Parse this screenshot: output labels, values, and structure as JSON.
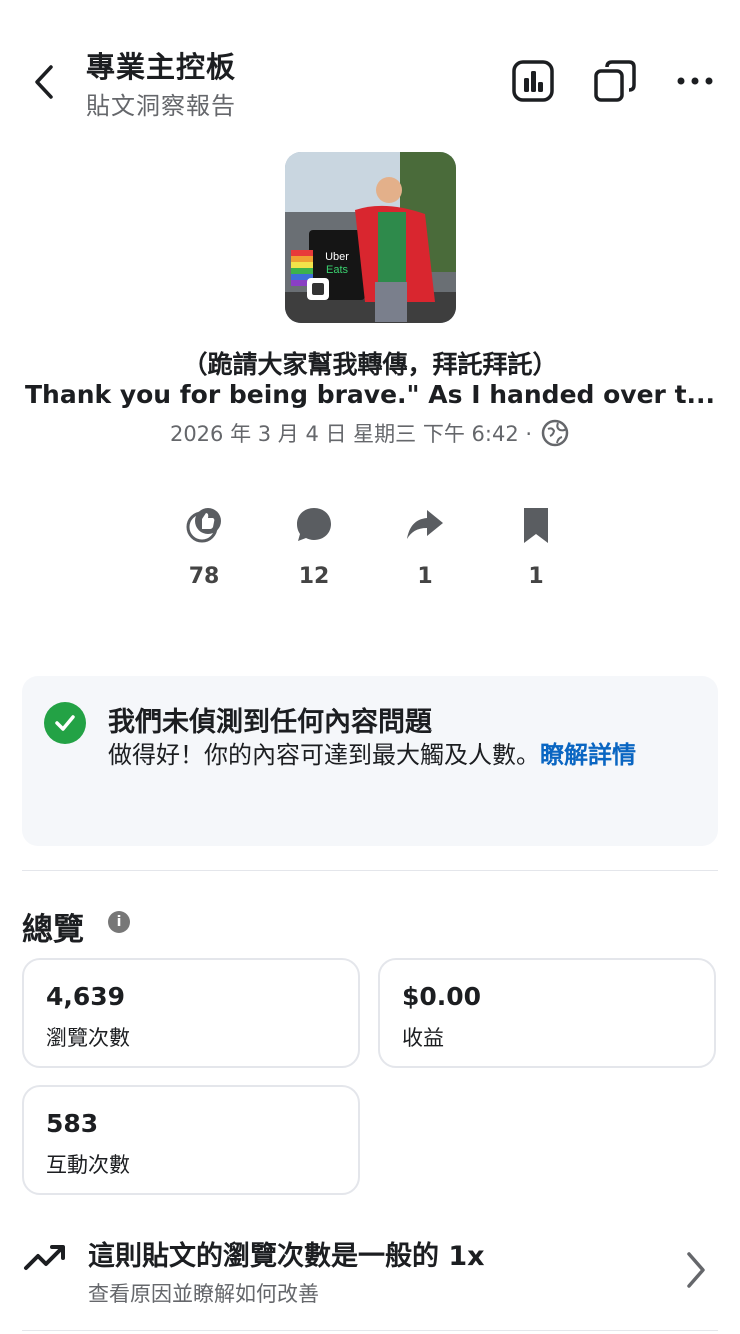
{
  "header": {
    "title": "專業主控板",
    "subtitle": "貼文洞察報告"
  },
  "post": {
    "thumbnail_text": "Uber Eats",
    "line1": "（跪請大家幫我轉傳，拜託拜託）",
    "line2": "Thank you for being brave.\" As I handed over t...",
    "date": "2026 年 3 月 4 日 星期三 下午 6:42 ·"
  },
  "engagement": {
    "reactions": "78",
    "comments": "12",
    "shares": "1",
    "saves": "1"
  },
  "notice": {
    "title": "我們未偵測到任何內容問題",
    "body": "做得好！你的內容可達到最大觸及人數。",
    "link": "瞭解詳情"
  },
  "overview": {
    "title": "總覽",
    "cards": [
      {
        "value": "4,639",
        "label": "瀏覽次數"
      },
      {
        "value": "$0.00",
        "label": "收益"
      },
      {
        "value": "583",
        "label": "互動次數"
      }
    ]
  },
  "trend": {
    "title": "這則貼文的瀏覽次數是一般的 1x",
    "subtitle": "查看原因並瞭解如何改善"
  },
  "colors": {
    "accent_link": "#0a66c2",
    "check_green": "#23a245",
    "muted_text": "#65676b"
  },
  "icons": [
    "back-arrow-icon",
    "insights-icon",
    "copy-icon",
    "more-icon",
    "globe-icon",
    "like-icon",
    "comment-icon",
    "share-icon",
    "bookmark-icon",
    "check-icon",
    "info-icon",
    "trend-up-icon",
    "chevron-right-icon"
  ]
}
